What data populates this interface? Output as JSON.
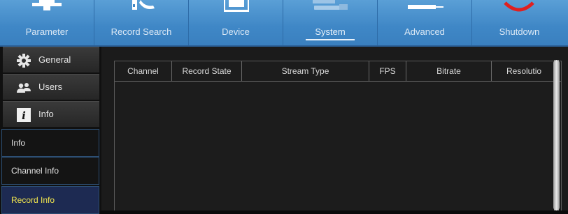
{
  "top_tabs": [
    {
      "label": "Parameter",
      "icon": "parameter-icon"
    },
    {
      "label": "Record Search",
      "icon": "record-search-icon"
    },
    {
      "label": "Device",
      "icon": "device-icon"
    },
    {
      "label": "System",
      "icon": "system-icon",
      "active": true
    },
    {
      "label": "Advanced",
      "icon": "advanced-icon"
    },
    {
      "label": "Shutdown",
      "icon": "shutdown-icon"
    }
  ],
  "sidebar": {
    "groups": [
      {
        "label": "General",
        "icon": "gear-icon"
      },
      {
        "label": "Users",
        "icon": "users-icon"
      },
      {
        "label": "Info",
        "icon": "info-icon"
      }
    ],
    "items": [
      {
        "label": "Info"
      },
      {
        "label": "Channel Info"
      },
      {
        "label": "Record Info",
        "active": true
      }
    ]
  },
  "table": {
    "columns": [
      "Channel",
      "Record State",
      "Stream Type",
      "FPS",
      "Bitrate",
      "Resolutio"
    ],
    "rows": []
  },
  "colors": {
    "tab_bar": "#3f87c6",
    "active_item_text": "#f2e64e",
    "shutdown_accent": "#e02020"
  }
}
